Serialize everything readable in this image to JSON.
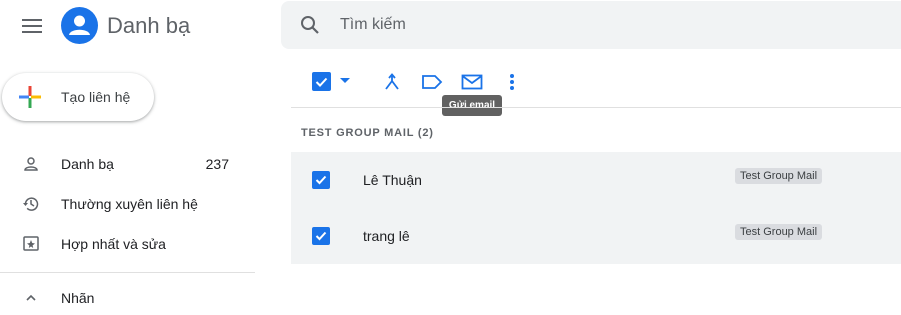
{
  "header": {
    "app_title": "Danh bạ",
    "search_placeholder": "Tìm kiếm"
  },
  "create_button": {
    "label": "Tạo liên hệ"
  },
  "nav": {
    "items": [
      {
        "label": "Danh bạ",
        "count": "237",
        "icon": "person-icon"
      },
      {
        "label": "Thường xuyên liên hệ",
        "count": "",
        "icon": "history-icon"
      },
      {
        "label": "Hợp nhất và sửa",
        "count": "",
        "icon": "merge-fix-icon"
      }
    ],
    "labels_section": {
      "label": "Nhãn",
      "icon": "chevron-up-icon"
    }
  },
  "toolbar": {
    "tooltip": "Gửi email",
    "icons": [
      "select-all-checkbox",
      "merge-icon",
      "label-icon",
      "email-icon",
      "more-vert-icon"
    ]
  },
  "group": {
    "header": "TEST GROUP MAIL (2)",
    "rows": [
      {
        "name": "Lê Thuận",
        "label": "Test Group Mail",
        "checked": true
      },
      {
        "name": "trang lê",
        "label": "Test Group Mail",
        "checked": true
      }
    ]
  },
  "colors": {
    "accent": "#1a73e8",
    "selected_row_bg": "#f1f3f4",
    "chip_bg": "#dadce0",
    "tooltip_bg": "#616161"
  }
}
